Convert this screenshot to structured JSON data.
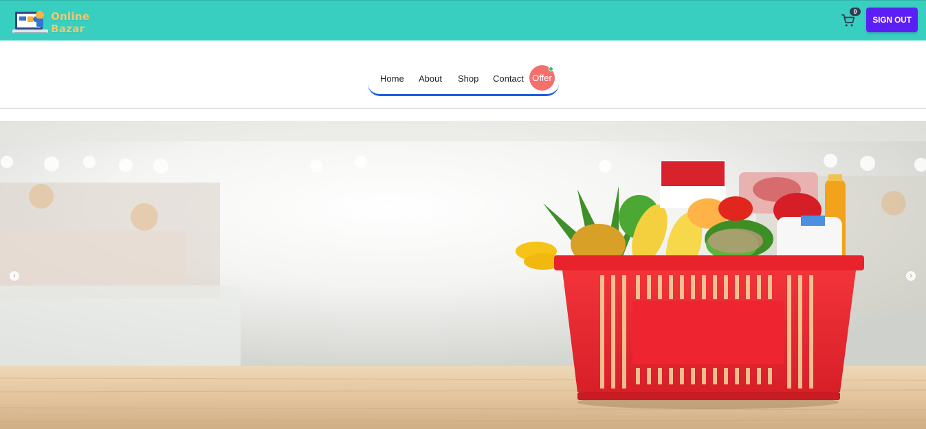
{
  "brand": {
    "name_line1": "Online",
    "name_line2": "Bazar",
    "logo_icon": "laptop-shop-logo-icon"
  },
  "header": {
    "cart_icon": "cart-icon",
    "cart_count": "0",
    "signout_label": "SIGN OUT",
    "bg_color": "#38cfc0",
    "button_color": "#5b1ef5"
  },
  "nav": {
    "items": [
      {
        "label": "Home"
      },
      {
        "label": "About"
      },
      {
        "label": "Shop"
      },
      {
        "label": "Contact"
      }
    ],
    "offer_label": "Offer",
    "offer_color": "#f3706d",
    "underline_color": "#1b5fe0"
  },
  "hero": {
    "image": "grocery-basket-banner",
    "prev_icon": "chevron-left-icon",
    "next_icon": "chevron-right-icon",
    "prev_glyph": "‹",
    "next_glyph": "›"
  }
}
